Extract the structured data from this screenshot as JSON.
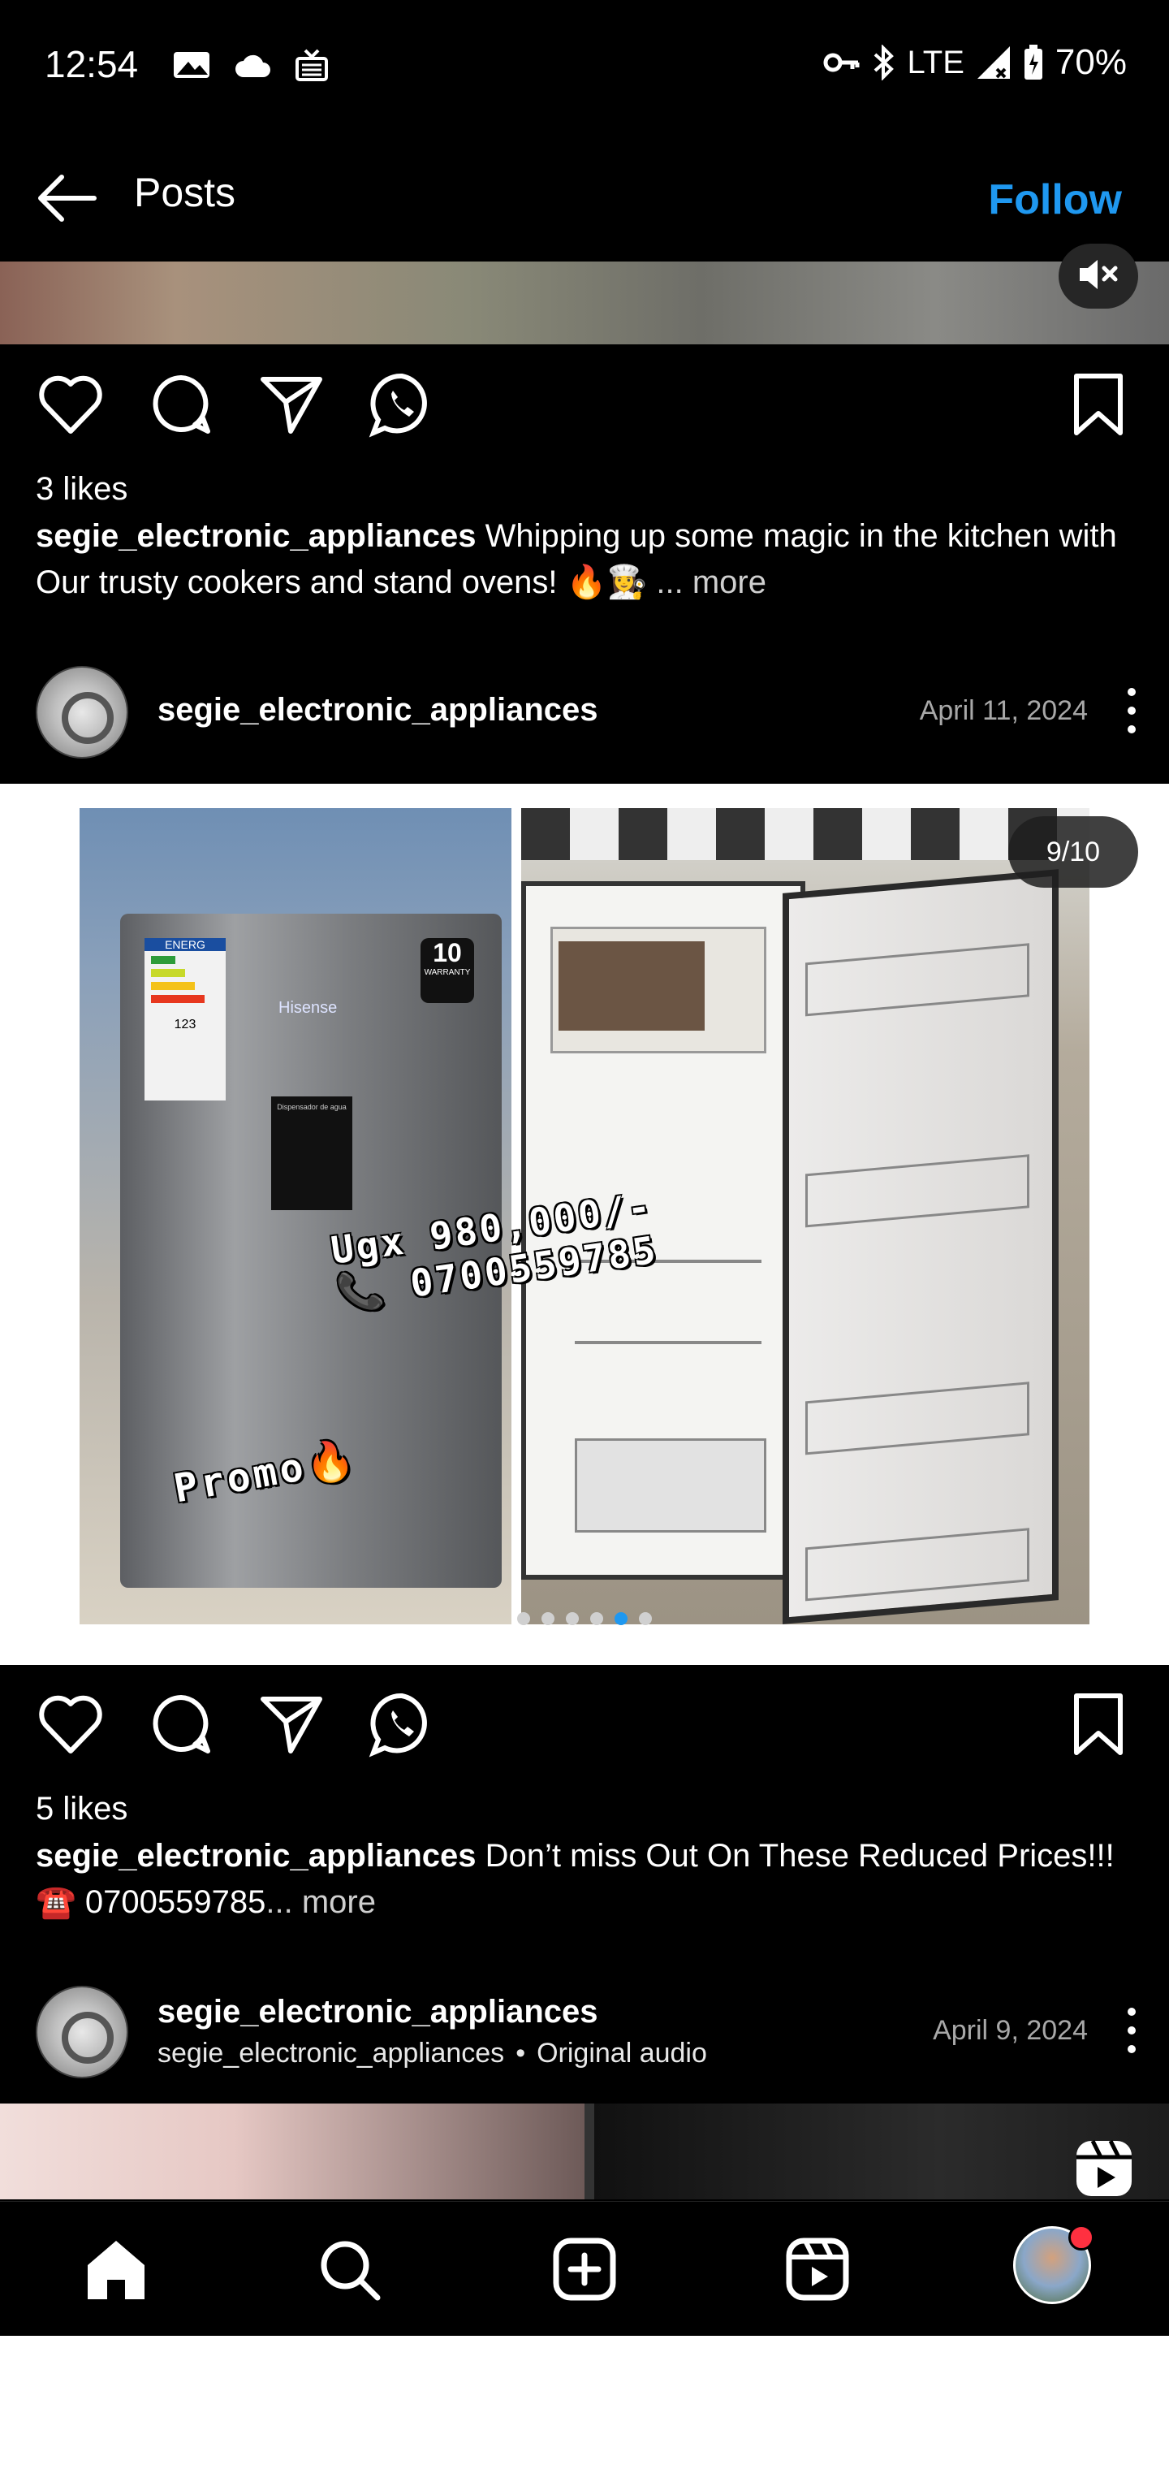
{
  "status_bar": {
    "time": "12:54",
    "network": "LTE",
    "battery": "70%",
    "icons": [
      "image-notification-icon",
      "cloud-icon",
      "cast-icon",
      "vpn-key-icon",
      "bluetooth-icon",
      "signal-icon",
      "battery-icon"
    ]
  },
  "header": {
    "title": "Posts",
    "follow_label": "Follow",
    "back_icon": "arrow-left-icon"
  },
  "post1": {
    "likes": "3 likes",
    "caption_user": "segie_electronic_appliances",
    "caption_text": " Whipping up some magic in the kitchen with Our trusty cookers and stand ovens! 🔥👩‍🍳 ",
    "more_label": "... more"
  },
  "post2": {
    "username": "segie_electronic_appliances",
    "date": "April 11, 2024",
    "counter": "9/10",
    "image_overlay": {
      "price": "Ugx 980,000/-",
      "phone": "📞 0700559785",
      "promo": "Promo🔥",
      "warranty_years": "10",
      "warranty_word": "WARRANTY",
      "brand": "Hisense",
      "dispenser": "Dispensador de agua",
      "energy_label": "ENERG",
      "energy_value": "123"
    },
    "carousel_dots_total": 6,
    "carousel_active_index": 4,
    "likes": "5 likes",
    "caption_user": "segie_electronic_appliances",
    "caption_text": " Don’t miss Out On These Reduced Prices!!! ☎️ 0700559785",
    "more_label": "... more"
  },
  "post3": {
    "username": "segie_electronic_appliances",
    "subtitle_user": "segie_electronic_appliances",
    "subtitle_audio": "Original audio",
    "subtitle_sep": "•",
    "date": "April 9, 2024"
  },
  "bottom_nav": {
    "items": [
      "home-icon",
      "search-icon",
      "create-icon",
      "reels-icon",
      "profile-avatar"
    ]
  },
  "colors": {
    "accent": "#1f98f0",
    "notification": "#ff3040"
  }
}
